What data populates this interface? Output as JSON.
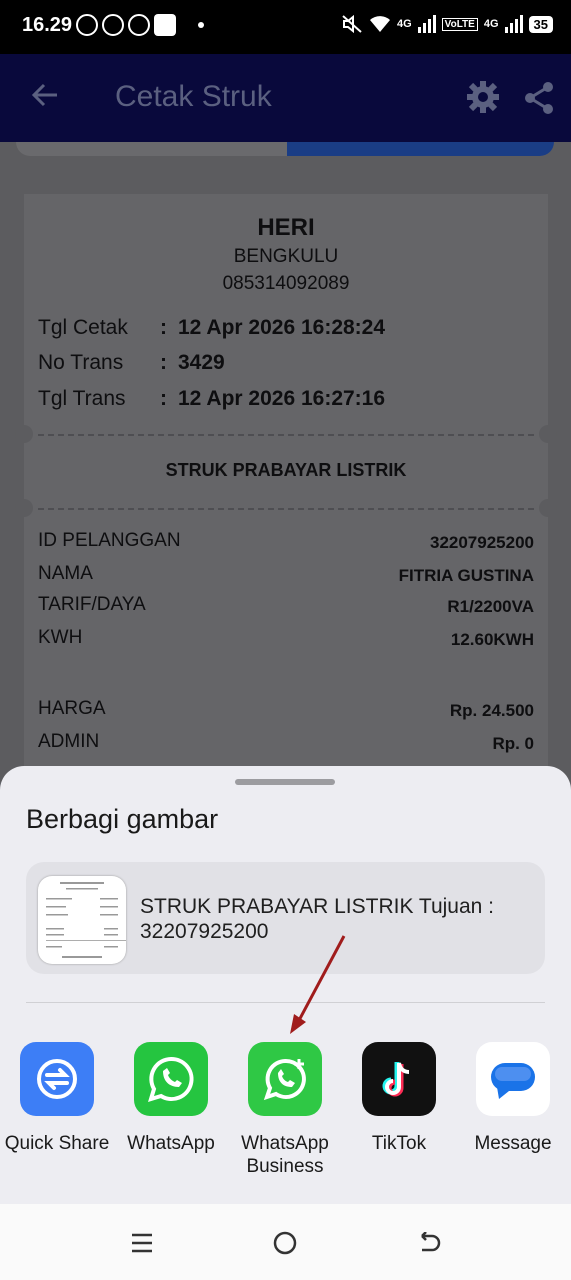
{
  "status": {
    "time": "16.29",
    "battery": "35",
    "net1": "4G",
    "net2": "VoLTE",
    "net3": "4G"
  },
  "appbar": {
    "title": "Cetak Struk"
  },
  "receipt": {
    "name": "HERI",
    "city": "BENGKULU",
    "phone": "085314092089",
    "meta": [
      {
        "label": "Tgl Cetak",
        "value": "12 Apr 2026 16:28:24"
      },
      {
        "label": "No Trans",
        "value": "3429"
      },
      {
        "label": "Tgl Trans",
        "value": "12 Apr 2026 16:27:16"
      }
    ],
    "type_title": "STRUK PRABAYAR LISTRIK",
    "details": [
      {
        "label": "ID PELANGGAN",
        "value": "32207925200"
      },
      {
        "label": "NAMA",
        "value": "FITRIA GUSTINA"
      },
      {
        "label": "TARIF/DAYA",
        "value": "R1/2200VA"
      },
      {
        "label": "KWH",
        "value": "12.60KWH"
      }
    ],
    "prices": [
      {
        "label": "HARGA",
        "value": "Rp. 24.500"
      },
      {
        "label": "ADMIN",
        "value": "Rp. 0"
      }
    ],
    "colon": ":"
  },
  "share": {
    "title": "Berbagi gambar",
    "preview_text": "STRUK PRABAYAR LISTRIK Tujuan : 32207925200",
    "apps": [
      {
        "label": "Quick Share",
        "icon": "quick-share-icon",
        "color": "#3d7ef6"
      },
      {
        "label": "WhatsApp",
        "icon": "whatsapp-icon",
        "color": "#25c540"
      },
      {
        "label": "WhatsApp Business",
        "icon": "whatsapp-business-icon",
        "color": "#2fc845"
      },
      {
        "label": "TikTok",
        "icon": "tiktok-icon",
        "color": "#111111"
      },
      {
        "label": "Message",
        "icon": "messages-icon",
        "color": "#ffffff"
      }
    ]
  }
}
